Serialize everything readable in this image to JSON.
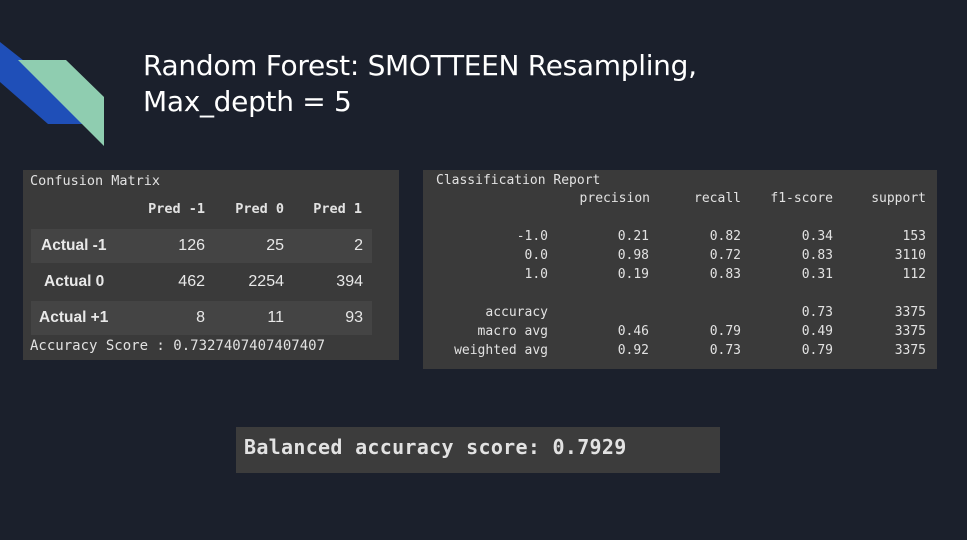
{
  "slide": {
    "title_line1": "Random Forest: SMOTTEEN Resampling,",
    "title_line2": "Max_depth = 5",
    "accent_colors": {
      "blue": "#1f4fb8",
      "green": "#8fcdb0",
      "background": "#1b202c"
    }
  },
  "confusion_matrix": {
    "title": "Confusion Matrix",
    "columns": [
      "Pred -1",
      "Pred 0",
      "Pred 1"
    ],
    "rows": [
      {
        "label": "Actual -1",
        "values": [
          "126",
          "25",
          "2"
        ]
      },
      {
        "label": "Actual 0",
        "values": [
          "462",
          "2254",
          "394"
        ]
      },
      {
        "label": "Actual +1",
        "values": [
          "8",
          "11",
          "93"
        ]
      }
    ],
    "accuracy_text": "Accuracy Score : 0.7327407407407407"
  },
  "classification_report": {
    "title": "Classification Report",
    "headers": [
      "precision",
      "recall",
      "f1-score",
      "support"
    ],
    "rows": [
      {
        "label": "-1.0",
        "precision": "0.21",
        "recall": "0.82",
        "f1": "0.34",
        "support": "153"
      },
      {
        "label": "0.0",
        "precision": "0.98",
        "recall": "0.72",
        "f1": "0.83",
        "support": "3110"
      },
      {
        "label": "1.0",
        "precision": "0.19",
        "recall": "0.83",
        "f1": "0.31",
        "support": "112"
      },
      {
        "label": "accuracy",
        "precision": "",
        "recall": "",
        "f1": "0.73",
        "support": "3375"
      },
      {
        "label": "macro avg",
        "precision": "0.46",
        "recall": "0.79",
        "f1": "0.49",
        "support": "3375"
      },
      {
        "label": "weighted avg",
        "precision": "0.92",
        "recall": "0.73",
        "f1": "0.79",
        "support": "3375"
      }
    ]
  },
  "balanced_accuracy": {
    "text": "Balanced accuracy score: 0.7929"
  }
}
